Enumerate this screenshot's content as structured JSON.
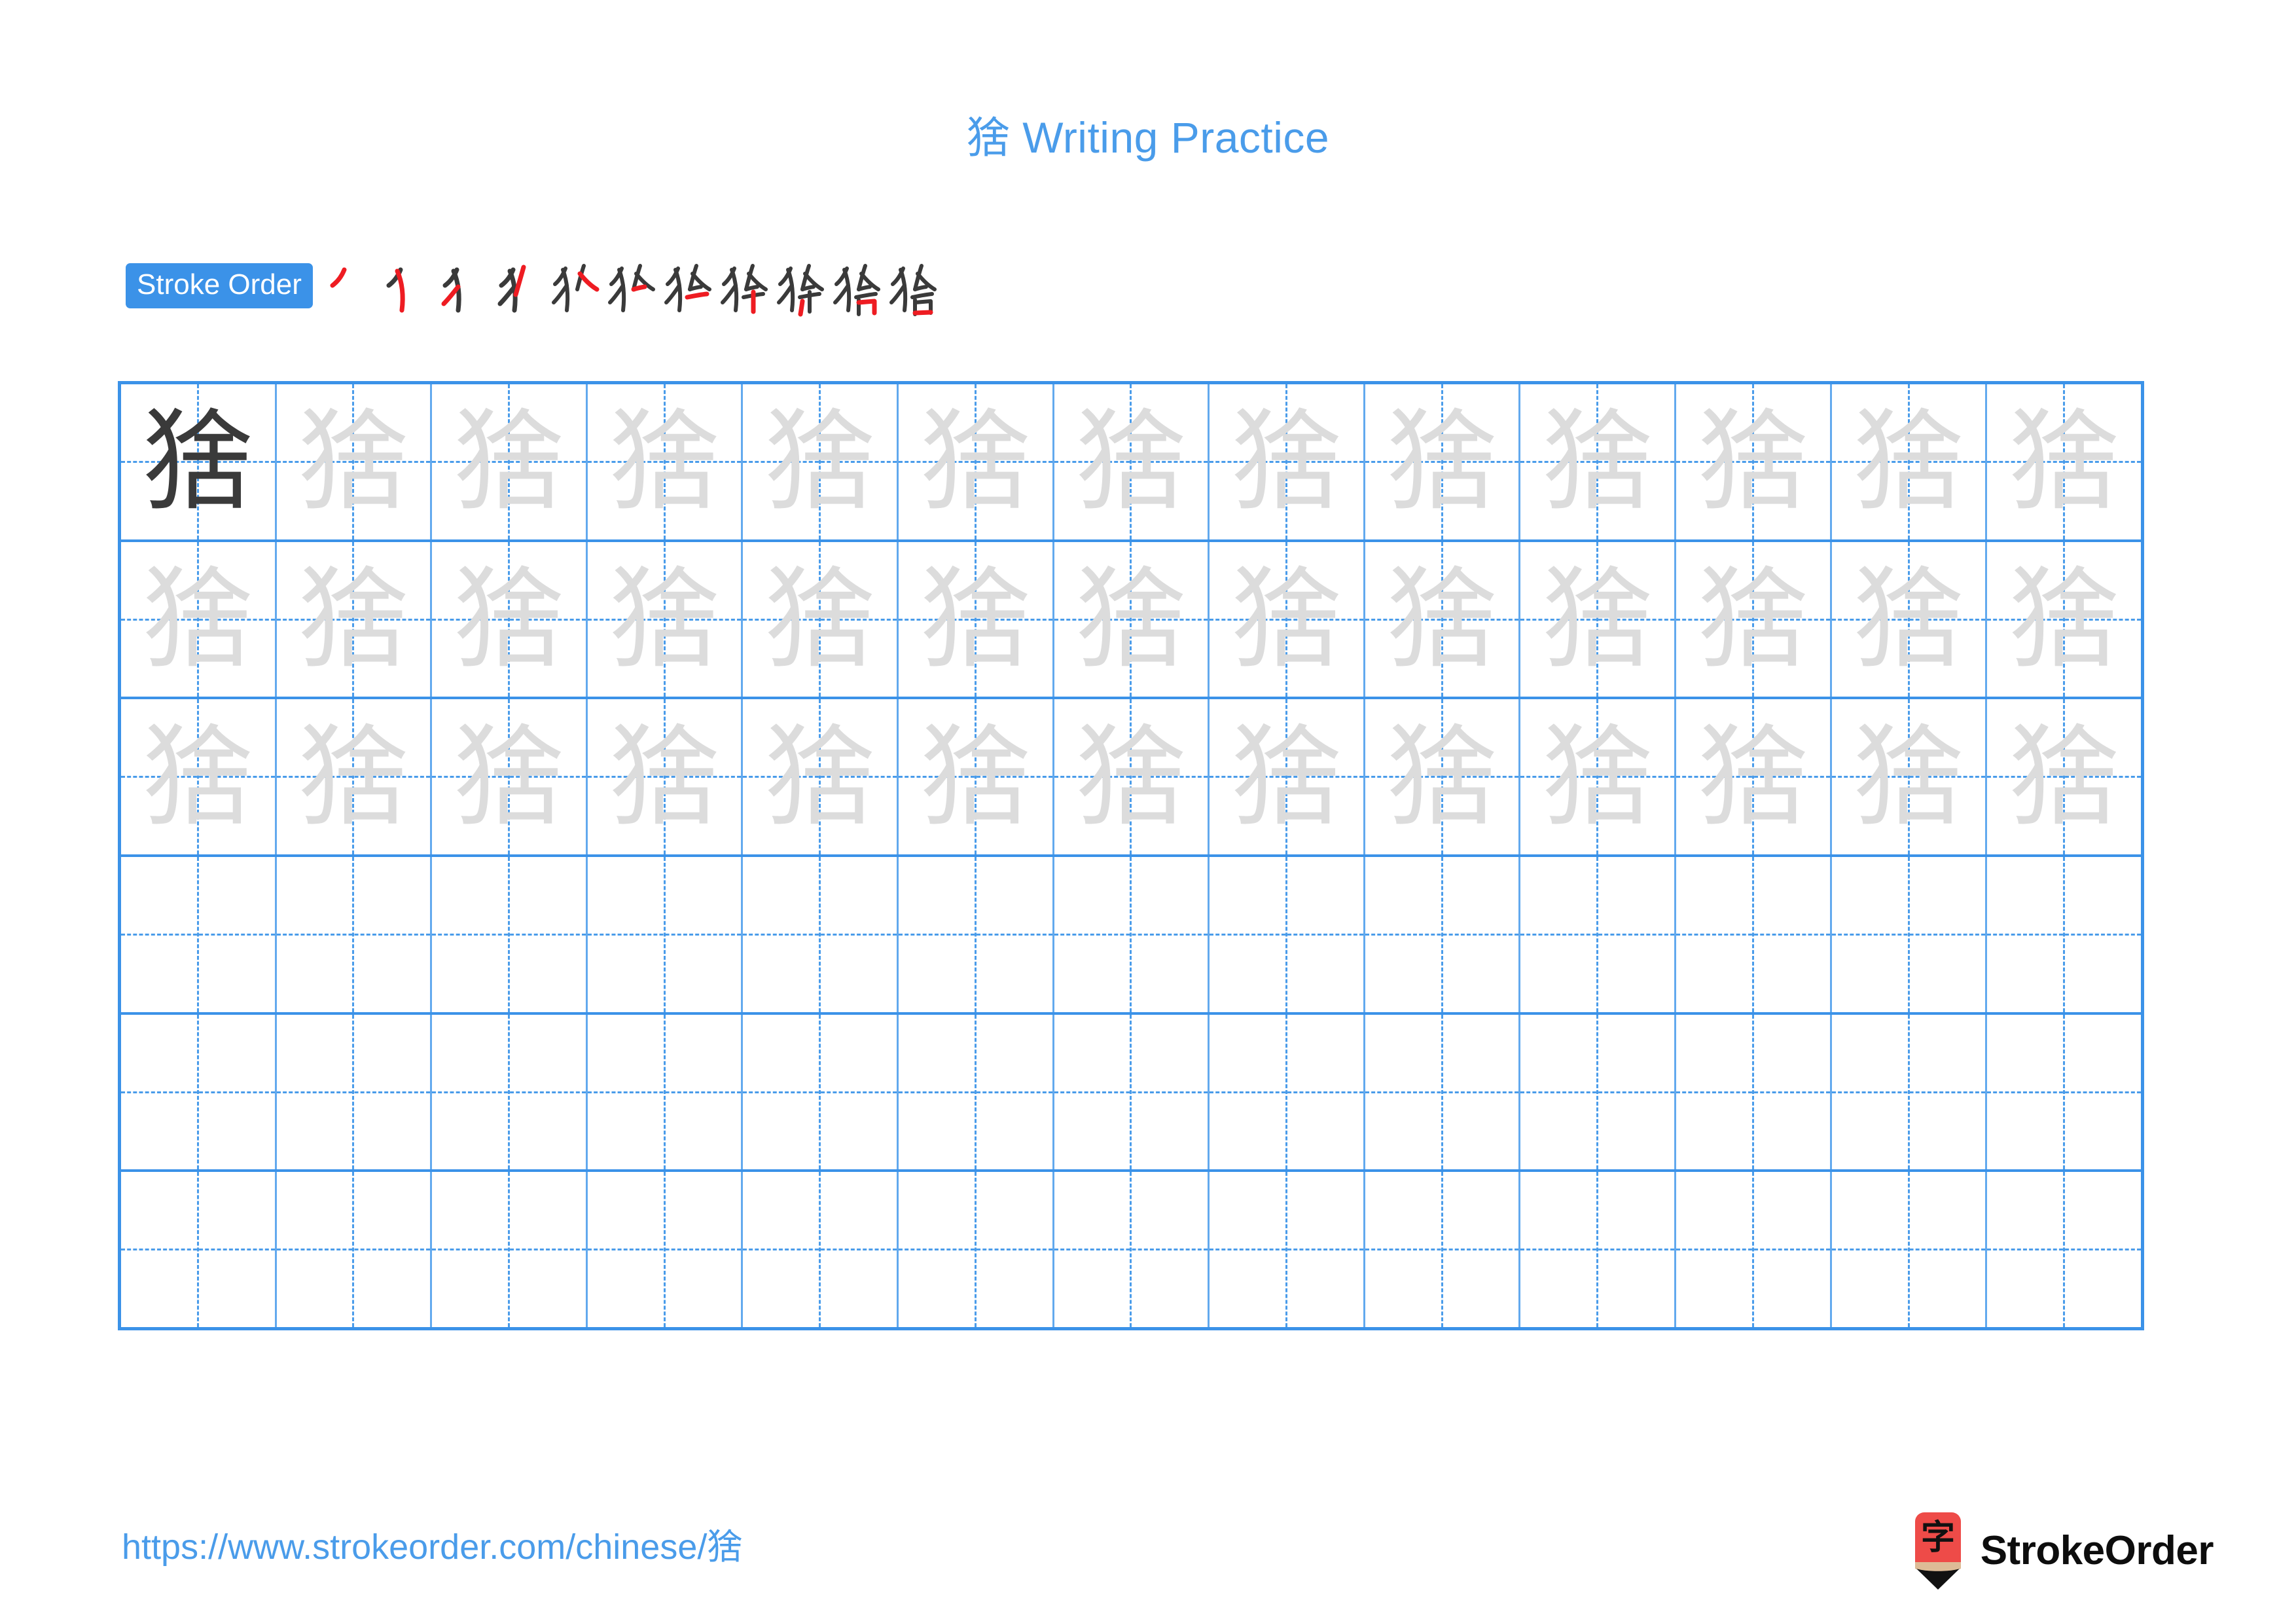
{
  "character": "猞",
  "title": {
    "text": "猞 Writing Practice",
    "color": "#4a9cea"
  },
  "stroke_order": {
    "badge_label": "Stroke Order",
    "badge_bg": "#3b92e8",
    "badge_text_color": "#ffffff",
    "total_strokes": 11,
    "new_stroke_color": "#ee1c22",
    "drawn_stroke_color": "#3a3a3a",
    "steps": [
      {
        "index": 1,
        "partial": "丿"
      },
      {
        "index": 2,
        "partial": "犭"
      },
      {
        "index": 3,
        "partial": "犭"
      },
      {
        "index": 4,
        "partial": "犭"
      },
      {
        "index": 5,
        "partial": "犭"
      },
      {
        "index": 6,
        "partial": "犭"
      },
      {
        "index": 7,
        "partial": "犭"
      },
      {
        "index": 8,
        "partial": "犭"
      },
      {
        "index": 9,
        "partial": "犭"
      },
      {
        "index": 10,
        "partial": "猞"
      },
      {
        "index": 11,
        "partial": "猞"
      }
    ]
  },
  "practice_grid": {
    "columns": 13,
    "rows": 6,
    "grid_line_color": "#3b92e8",
    "guide_line_color": "#4a9cea",
    "model_char_color": "#3a3a3a",
    "trace_char_color": "#dcdcdc",
    "cells": [
      [
        "猞",
        "猞",
        "猞",
        "猞",
        "猞",
        "猞",
        "猞",
        "猞",
        "猞",
        "猞",
        "猞",
        "猞",
        "猞"
      ],
      [
        "猞",
        "猞",
        "猞",
        "猞",
        "猞",
        "猞",
        "猞",
        "猞",
        "猞",
        "猞",
        "猞",
        "猞",
        "猞"
      ],
      [
        "猞",
        "猞",
        "猞",
        "猞",
        "猞",
        "猞",
        "猞",
        "猞",
        "猞",
        "猞",
        "猞",
        "猞",
        "猞"
      ],
      [
        "",
        "",
        "",
        "",
        "",
        "",
        "",
        "",
        "",
        "",
        "",
        "",
        ""
      ],
      [
        "",
        "",
        "",
        "",
        "",
        "",
        "",
        "",
        "",
        "",
        "",
        "",
        ""
      ],
      [
        "",
        "",
        "",
        "",
        "",
        "",
        "",
        "",
        "",
        "",
        "",
        "",
        ""
      ]
    ]
  },
  "footer": {
    "url": "https://www.strokeorder.com/chinese/猞",
    "url_color": "#4a9cea",
    "brand_name": "StrokeOrder",
    "brand_icon_char": "字",
    "brand_icon_body_color": "#ee4b48",
    "brand_icon_wood_color": "#ddbb96",
    "brand_icon_tip_color": "#111111"
  }
}
